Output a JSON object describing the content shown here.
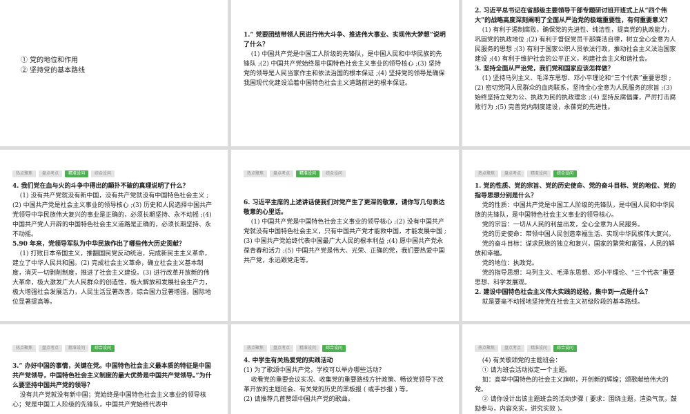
{
  "tabs": [
    "热点聚焦",
    "盘点考点",
    "精准设问",
    "综合设问"
  ],
  "slides": [
    {
      "id": "s1",
      "active": 1,
      "items": [
        {
          "t": "li",
          "text": "① 党的地位和作用"
        },
        {
          "t": "li",
          "text": "② 坚持党的基本路线"
        }
      ]
    },
    {
      "id": "s2",
      "active": 2,
      "items": [
        {
          "t": "q",
          "text": "1.“ 党要团结带领人民进行伟大斗争、推进伟大事业、实现伟大梦想”说明了什么？"
        },
        {
          "t": "p",
          "text": "(1) 中国共产党是中国工人阶级的先锋队，是中国人民和中华民族的先锋队 ;(2) 中国共产党始终是中国特色社会主义事业的领导核心 ;(3) 坚持党的领导是人民当家作主和依法治国的根本保证 ;(4) 坚持党的领导是确保我国现代化建设沿着中国特色社会主义道路前进的根本保证。"
        }
      ]
    },
    {
      "id": "s3",
      "active": 2,
      "items": [
        {
          "t": "q",
          "text": "2. 习近平总书记在省部级主要领导干部专题研讨班开班式上从“四个伟大”的战略高度深刻阐明了全面从严治党的极端重要性，有何重要意义？"
        },
        {
          "t": "p",
          "text": "(1) 有利于遏制腐败，确保党的先进性、纯洁性，提高党的执政能力，巩固党的执政地位 ;(2) 有利于督促党员干部廉洁自律，树立全心全意为人民服务的思想 ;(3) 有利于国家公职人员依法行政，推动社会主义法治国家建设 ;(4) 有利于维护社会的公平正义，构建社会主义和谐社会。"
        },
        {
          "t": "q",
          "text": "3. 坚持全面从严治党，我们党和国家应该怎样做？"
        },
        {
          "t": "p",
          "text": "(1) 坚持马列主义、毛泽东思想、邓小平理论和“三个代表”重要思想 ;(2) 密切党同人民群众的血肉联系，坚持全心全意为人民服务的宗旨 ;(3) 始终坚持立党为公、执政为民的执政理念 ;(4) 坚持反腐倡廉，严厉打击腐败行为 ;(5) 完善党内制度建设，永葆党的先进性。"
        }
      ]
    },
    {
      "id": "s4",
      "active": 2,
      "items": [
        {
          "t": "q",
          "text": "4. 我们党在血与火的斗争中得出的颠扑不破的真理说明了什么？"
        },
        {
          "t": "p",
          "text": "(1) 没有共产党就没有新中国，没有共产党就没有中国特色社会主义 ;(2) 中国共产党是社会主义事业的领导核心 ;(3) 历史和人民选择中国共产党领导中华民族伟大复兴的事业是正确的，必须长期坚持、永不动摇 ;(4) 中国共产党人开辟的中国特色社会主义道路是正确的，必须长期坚持、永不动摇。"
        },
        {
          "t": "q",
          "text": "5.90 年来，党领导军队为中华民族作出了哪些伟大历史贡献？"
        },
        {
          "t": "p",
          "text": "(1) 打败日本帝国主义，推翻国民党反动统治，完成新民主主义革命，建立了中华人民共和国。(2) 完成社会主义革命，确立社会主义基本制度，消灭一切剥削制度，推进了社会主义建设。(3) 进行改革开放新的伟大革命，极大激发广大人民群众的创造性，极大解放和发展社会生产力，极大增强社会发展活力，人民生活显著改善，综合国力显著增强，国际地位显著提高等。"
        }
      ]
    },
    {
      "id": "s5",
      "active": 2,
      "items": [
        {
          "t": "q",
          "text": "6. 习近平主席的上述讲话使我们对党产生了更深的敬意，请你写几句表达敬意的心里话。"
        },
        {
          "t": "p",
          "text": "(1) 中国共产党是中国特色社会主义事业的领导核心 ;(2) 没有中国共产党就没有中国特色社会主义，只有中国共产党才能救中国，才能发展中国 ;(3) 中国共产党始终代表中国最广大人民的根本利益 ;(4) 愿中国共产党永葆青春和活力 ;(5) 中国共产党是伟大、光荣、正确的党，我们要热爱中国共产党，永远跟党走等。"
        }
      ]
    },
    {
      "id": "s6",
      "active": 3,
      "items": [
        {
          "t": "q",
          "text": "1. 党的性质、党的宗旨、党的历史使命、党的奋斗目标、党的地位、党的指导思想分别是什么？"
        },
        {
          "t": "p",
          "text": "党的性质：中国共产党是中国工人阶级的先锋队，是中国人民和中华民族的先锋队，是中国特色社会主义事业的领导核心。"
        },
        {
          "t": "p",
          "text": "党的宗旨：一切从人民的利益出发，全心全意为人民服务。"
        },
        {
          "t": "p",
          "text": "党的历史使命：带领中国人民创造幸福生活、实现中华民族伟大复兴。"
        },
        {
          "t": "p",
          "text": "党的奋斗目标：谋求民族的独立和复兴，国家的繁荣和富强，人民的解放和幸福。"
        },
        {
          "t": "p",
          "text": "党的地位：执政党。"
        },
        {
          "t": "p",
          "text": "党的指导思想：马列主义、毛泽东思想、邓小平理论、“三个代表”重要思想、科学发展观。"
        },
        {
          "t": "q",
          "text": "2. 建设中国特色社会主义伟大实践的经验，集中到一点是什么？"
        },
        {
          "t": "p",
          "text": "就是要毫不动摇地坚持党在社会主义初级阶段的基本路线。"
        }
      ]
    },
    {
      "id": "s7",
      "active": 3,
      "items": [
        {
          "t": "q",
          "text": "3.“ 办好中国的事情，关键在党。中国特色社会主义最本质的特征是中国共产党领导，中国特色社会主义制度的最大优势是中国共产党领导。”为什么要坚持中国共产党的领导？"
        },
        {
          "t": "p",
          "text": "没有共产党就没有新中国；党始终是中国特色社会主义事业的领导核心；党是中国工人阶级的先锋队，中国共产党始终代表中"
        }
      ]
    },
    {
      "id": "s8",
      "active": 3,
      "items": [
        {
          "t": "q",
          "text": "4. 中学生有关热爱党的实践活动"
        },
        {
          "t": "plain",
          "text": "(1) 为了歌颂中国共产党，学校可以举办哪些活动？"
        },
        {
          "t": "p",
          "text": "收看党的重要会议实况、收集党的重要路线方针政策、畅谈党领导下改革开放的主题班会、有关党的历史的黑板报 ( 或手抄报 ) 等。"
        },
        {
          "t": "plain",
          "text": "(2) 请推荐几首赞颂中国共产党的歌曲。"
        }
      ]
    },
    {
      "id": "s9",
      "active": 3,
      "items": [
        {
          "t": "p",
          "text": "(4) 有关歌颂党的主题班会："
        },
        {
          "t": "p",
          "text": "① 请为班会活动拟定一个主题。"
        },
        {
          "t": "p",
          "text": "如：高举中国特色的社会主义旗帜，开创新的辉煌；颂歌献给伟大的党。"
        },
        {
          "t": "p",
          "text": "② 请你设计出该主题班会的活动步骤 ( 要求：围绕主题，渲染气氛，鼓励参与，内容充实，讲究实效 )。"
        }
      ]
    }
  ]
}
